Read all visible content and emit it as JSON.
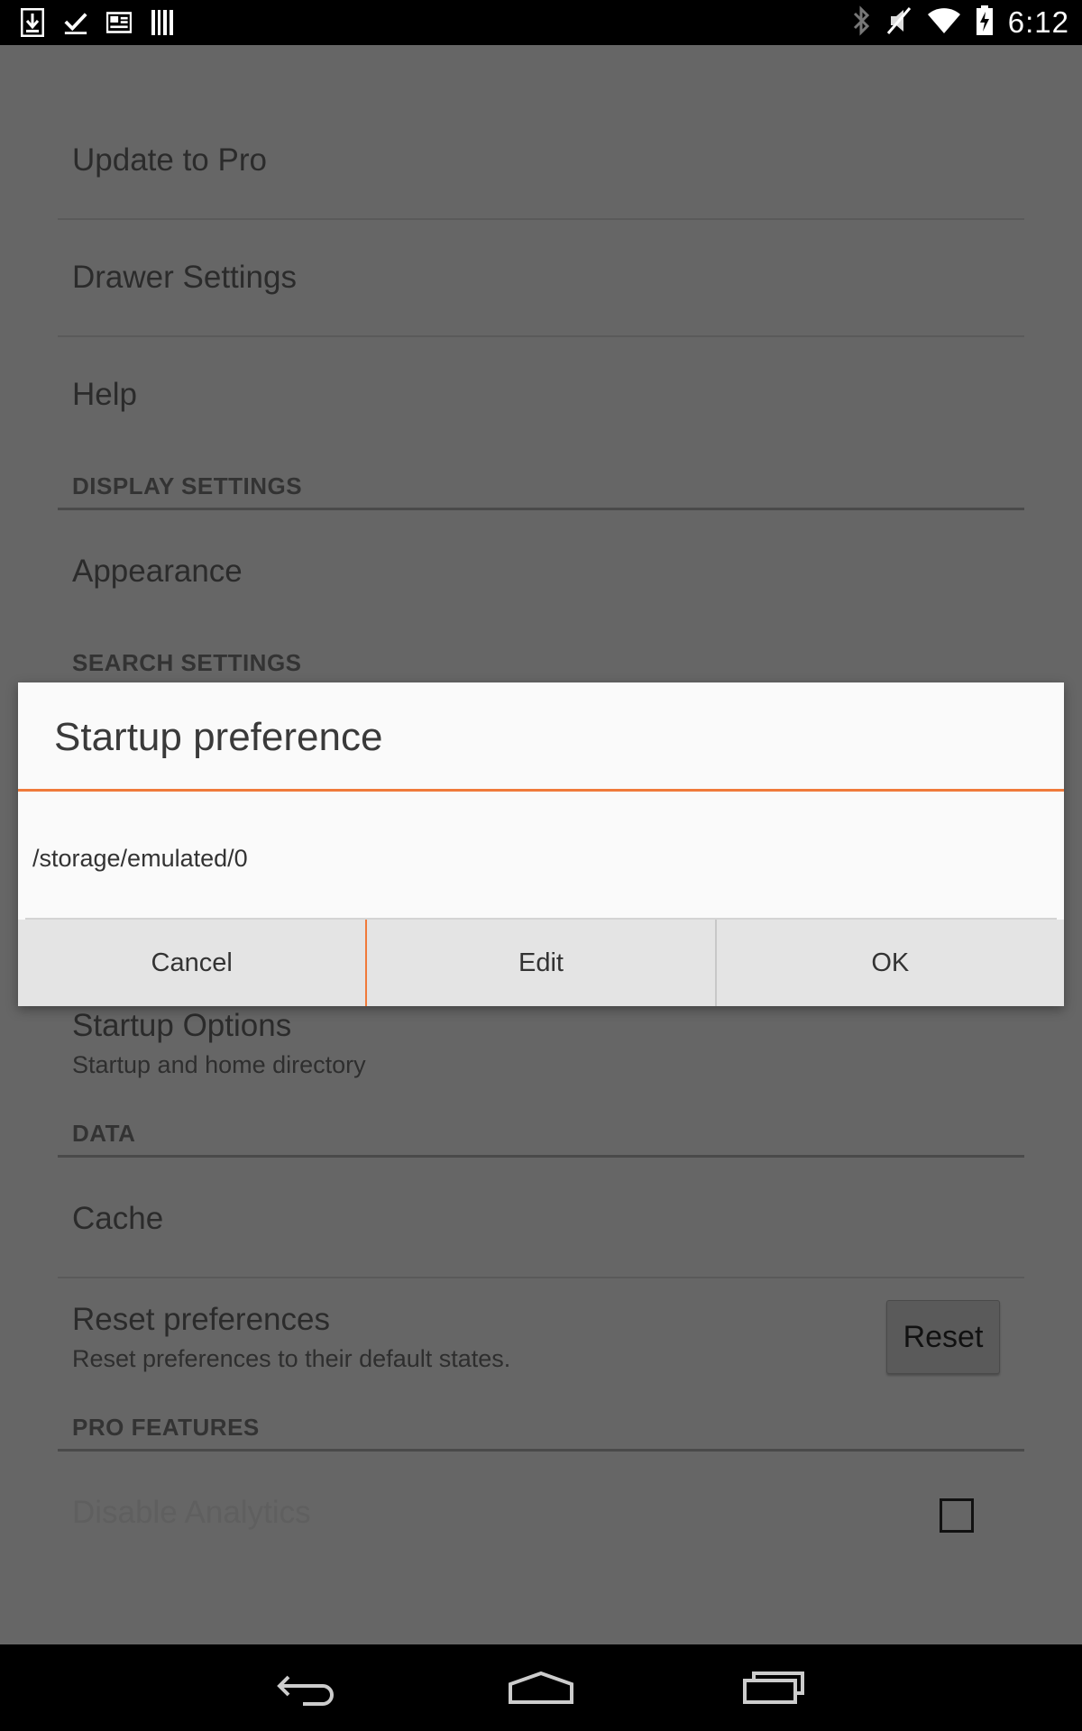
{
  "status_bar": {
    "time": "6:12",
    "left_icons": [
      "download-icon",
      "checkmark-icon",
      "news-icon",
      "barcode-icon"
    ],
    "right_icons": [
      "bluetooth-icon",
      "mute-icon",
      "wifi-icon",
      "battery-charging-icon"
    ]
  },
  "settings": {
    "items": {
      "update_pro": "Update to Pro",
      "drawer": "Drawer Settings",
      "help": "Help",
      "appearance": "Appearance",
      "startup_options": "Startup Options",
      "startup_options_summary": "Startup and home directory",
      "cache": "Cache",
      "reset_prefs": "Reset preferences",
      "reset_prefs_summary": "Reset preferences to their default states.",
      "reset_button": "Reset",
      "disable_analytics": "Disable Analytics",
      "disable_analytics_checked": false
    },
    "sections": {
      "display": "DISPLAY SETTINGS",
      "search": "SEARCH SETTINGS",
      "data": "DATA",
      "pro": "PRO FEATURES"
    }
  },
  "dialog": {
    "title": "Startup preference",
    "path": "/storage/emulated/0",
    "buttons": {
      "cancel": "Cancel",
      "edit": "Edit",
      "ok": "OK"
    },
    "accent_color": "#f07a3a"
  },
  "nav_bar": {
    "icons": [
      "back-icon",
      "home-icon",
      "recents-icon"
    ]
  }
}
